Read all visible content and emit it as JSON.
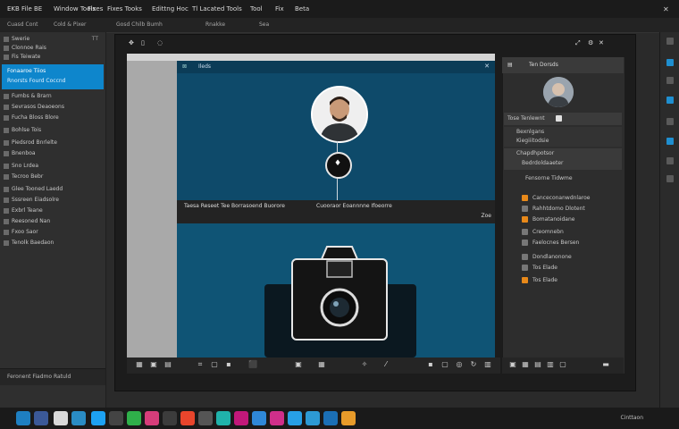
{
  "menubar": {
    "items": [
      "EKB File BE",
      "Window Tools",
      "Fixes",
      "Fixes Tooks",
      "Edittng Hoc",
      "Tl Lacated Tools",
      "Tool",
      "Fix",
      "Beta"
    ]
  },
  "controls": [
    "Cuasd Cont",
    "Cold & Pixer",
    "Gosd Chilb Bumh",
    "Rnakke",
    "Sea"
  ],
  "left_panel": {
    "rows": [
      {
        "label": "Swerie",
        "right": "TT"
      },
      {
        "label": "Clonnoe Rais",
        "right": ""
      },
      {
        "label": "Fis Teiwate",
        "right": ""
      },
      {
        "label": "Tresgtiuer Haes",
        "right": ""
      }
    ],
    "selected": {
      "line1": "Fonaaroe Tiios",
      "line2": "Rnorsts Fourd Coccnd"
    },
    "rows2": [
      {
        "label": "Fumbs & Brarn",
        "right": ""
      },
      {
        "label": "Sevrasos Deaoeons",
        "right": ""
      },
      {
        "label": "Fucha Bloss Blore",
        "right": ""
      },
      {
        "label": "Bohlse Tois",
        "right": ""
      },
      {
        "label": "Piedsrod Bnrlelte",
        "right": ""
      },
      {
        "label": "Bnenboa",
        "right": ""
      },
      {
        "label": "Sno Lrdea",
        "right": ""
      },
      {
        "label": "Tecroo Bebr",
        "right": ""
      },
      {
        "label": "Glee Tooned Laedd",
        "right": ""
      },
      {
        "label": "Sssreen Eiadsolre",
        "right": ""
      },
      {
        "label": "Exbrl Teane",
        "right": ""
      },
      {
        "label": "Reesoned Nan",
        "right": ""
      },
      {
        "label": "Fxoo Saor",
        "right": ""
      },
      {
        "label": "Tenolk Baedaon",
        "right": ""
      }
    ],
    "footer": "Feronent Fiadmo Ratuld"
  },
  "canvas": {
    "caption_left": "Taesa Reseet Tee Borrasoend Buorore",
    "caption_right": "Cuooraor Eoannnne Ifoeorre",
    "zoom": "Zoe",
    "top_label": "Ileds"
  },
  "right_panel": {
    "title": "Ten Dorsds",
    "rows": [
      {
        "label": "Tose Tenlewnt",
        "icon": "w"
      },
      {
        "label": "Bexnlgans",
        "icon": ""
      },
      {
        "label": "Kiegiiitodsie",
        "icon": ""
      },
      {
        "label": "Chapdhpotsor",
        "icon": ""
      },
      {
        "label": "Bedrdoldaaeter",
        "icon": ""
      },
      {
        "label": "Fensorne Tidwme",
        "icon": ""
      },
      {
        "label": "Canceconanwdnlaroe",
        "icon": "o"
      },
      {
        "label": "Rahhtdomo Dlotent",
        "icon": ""
      },
      {
        "label": "Bomatanoidane",
        "icon": ""
      },
      {
        "label": "Creomnebn",
        "icon": ""
      },
      {
        "label": "Faelocnes Bersen",
        "icon": ""
      },
      {
        "label": "Dondlanonone",
        "icon": ""
      },
      {
        "label": "Tos Elade",
        "icon": "o"
      }
    ]
  },
  "dock_clock": "Cinttaon",
  "colors": {
    "accent": "#0e86cc",
    "canvas": "#0e4a6a",
    "orange": "#e8891a"
  }
}
